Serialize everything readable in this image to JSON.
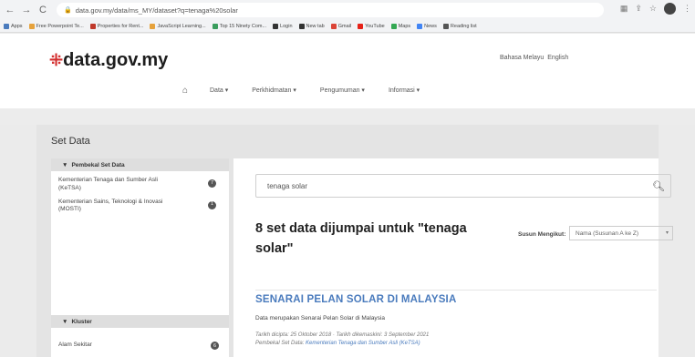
{
  "browser": {
    "url": "data.gov.my/data/ms_MY/dataset?q=tenaga%20solar",
    "bookmarks": [
      {
        "label": "Apps",
        "icon": "apps-icon",
        "color": "#4a7bbd"
      },
      {
        "label": "Free Powerpoint Te...",
        "icon": "folder-icon",
        "color": "#e6a23c"
      },
      {
        "label": "Properties for Rent...",
        "icon": "property-icon",
        "color": "#c0392b"
      },
      {
        "label": "JavaScript Learning...",
        "icon": "js-icon",
        "color": "#e6a23c"
      },
      {
        "label": "Top 15 Ninety Com...",
        "icon": "page-icon",
        "color": "#3a9d5d"
      },
      {
        "label": "Login",
        "icon": "globe-icon",
        "color": "#333333"
      },
      {
        "label": "New tab",
        "icon": "globe-icon",
        "color": "#333333"
      },
      {
        "label": "Gmail",
        "icon": "gmail-icon",
        "color": "#db4437"
      },
      {
        "label": "YouTube",
        "icon": "youtube-icon",
        "color": "#e62117"
      },
      {
        "label": "Maps",
        "icon": "maps-icon",
        "color": "#34a853"
      },
      {
        "label": "News",
        "icon": "news-icon",
        "color": "#4285f4"
      },
      {
        "label": "Reading list",
        "icon": "reading-list-icon",
        "color": "#555555"
      }
    ]
  },
  "site": {
    "logo_mark": "⁜",
    "logo_text": "data.gov.my",
    "lang_ms": "Bahasa Melayu",
    "lang_en": "English",
    "nav": [
      "Data ▾",
      "Perkhidmatan ▾",
      "Pengumuman ▾",
      "Informasi ▾"
    ]
  },
  "page": {
    "title": "Set Data",
    "sidebar": {
      "org_heading": "Pembekal Set Data",
      "orgs": [
        {
          "name": "Kementerian Tenaga dan Sumber Asli (KeTSA)",
          "count": "7"
        },
        {
          "name": "Kementerian Sains, Teknologi & Inovasi (MOSTI)",
          "count": "1"
        }
      ],
      "cluster_heading": "Kluster",
      "clusters": [
        {
          "name": "Alam Sekitar",
          "count": "6"
        }
      ]
    },
    "search": {
      "value": "tenaga solar"
    },
    "result_count": "8 set data dijumpai untuk \"tenaga solar\"",
    "sort": {
      "label": "Susun Mengikut:",
      "selected": "Nama (Susunan A ke Z)"
    },
    "dataset": {
      "title": "SENARAI PELAN SOLAR DI MALAYSIA",
      "description": "Data merupakan Senarai Pelan Solar di Malaysia",
      "dates": "Tarikh dicipta: 25 Oktober 2018 · Tarikh dikemaskini: 3 September 2021",
      "provider_label": "Pembekal Set Data:",
      "provider": "Kementerian Tenaga dan Sumber Asli (KeTSA)"
    }
  }
}
